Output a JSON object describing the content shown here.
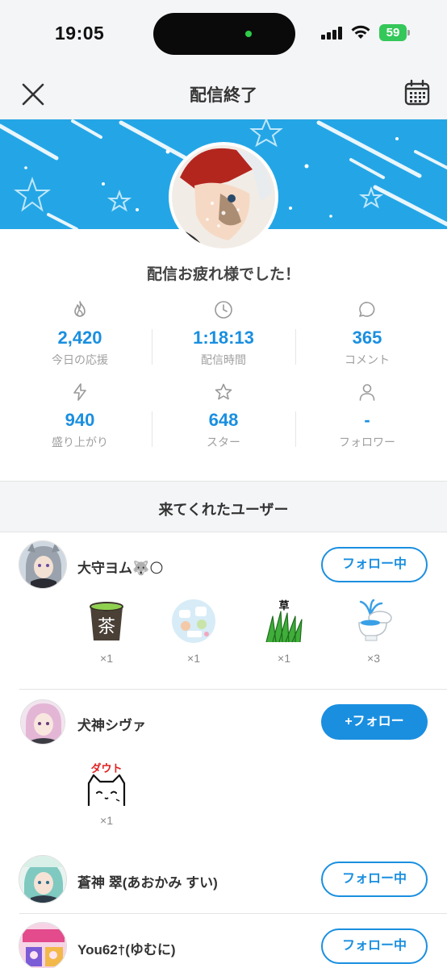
{
  "status_bar": {
    "time": "19:05",
    "battery": "59"
  },
  "nav": {
    "title": "配信終了"
  },
  "stream": {
    "thanks_message": "配信お疲れ様でした！"
  },
  "stats": [
    {
      "icon": "fire-icon",
      "value": "2,420",
      "label": "今日の応援"
    },
    {
      "icon": "clock-icon",
      "value": "1:18:13",
      "label": "配信時間"
    },
    {
      "icon": "comment-icon",
      "value": "365",
      "label": "コメント"
    },
    {
      "icon": "lightning-icon",
      "value": "940",
      "label": "盛り上がり"
    },
    {
      "icon": "star-icon",
      "value": "648",
      "label": "スター"
    },
    {
      "icon": "person-icon",
      "value": "-",
      "label": "フォロワー"
    }
  ],
  "visitors": {
    "title": "来てくれたユーザー",
    "users": [
      {
        "name": "大守ヨム🐺🌕",
        "follow_label": "フォロー中",
        "gifts": [
          {
            "icon": "tea-cup-icon",
            "label": "茶",
            "count": "×1"
          },
          {
            "icon": "sticker-icon",
            "count": "×1"
          },
          {
            "icon": "grass-icon",
            "label": "草",
            "count": "×1"
          },
          {
            "icon": "toilet-fountain-icon",
            "count": "×3"
          }
        ]
      },
      {
        "name": "犬神シヴァ",
        "follow_label": "+フォロー",
        "gifts": [
          {
            "icon": "doubt-cat-icon",
            "label": "ダウト",
            "count": "×1"
          }
        ]
      },
      {
        "name": "蒼神 翠(あおかみ すい)",
        "follow_label": "フォロー中"
      },
      {
        "name": "You62†(ゆむに)",
        "follow_label": "フォロー中"
      }
    ]
  },
  "colors": {
    "accent": "#1a8fe0",
    "banner": "#24a6e6"
  }
}
